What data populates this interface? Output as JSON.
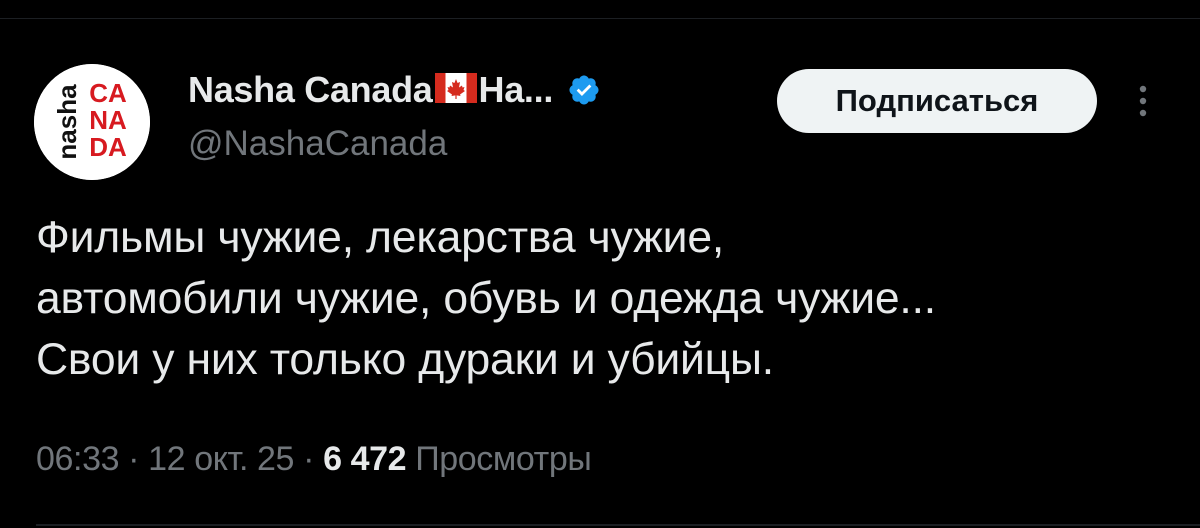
{
  "author": {
    "display_name_prefix": "Nasha Canada",
    "display_name_suffix": "На...",
    "handle": "@NashaCanada",
    "avatar": {
      "logo_word": "nasha",
      "logo_letters": [
        "CA",
        "NA",
        "DA"
      ],
      "brand_color": "#d71a20"
    },
    "verified_color": "#1d9bf0"
  },
  "follow_button": {
    "label": "Подписаться"
  },
  "tweet": {
    "lines": [
      "Фильмы чужие, лекарства чужие,",
      "автомобили чужие, обувь и одежда чужие...",
      "Свои у них только дураки и убийцы."
    ]
  },
  "meta": {
    "time": "06:33",
    "separator": "·",
    "date": "12 окт. 25",
    "views_count": "6 472",
    "views_label": "Просмотры"
  }
}
